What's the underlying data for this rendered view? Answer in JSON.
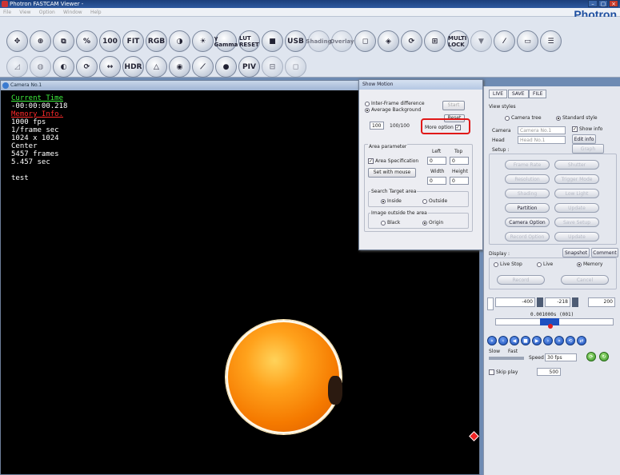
{
  "window": {
    "title": "Photron FASTCAM Viewer -",
    "brand": "Photron"
  },
  "menu": [
    "File",
    "View",
    "Option",
    "Window",
    "Help"
  ],
  "toolbar": {
    "row1": [
      "✥",
      "⊕",
      "⧉",
      "%",
      "100",
      "FIT",
      "RGB",
      "◑",
      "☀",
      "γ Gamma",
      "LUT RESET",
      "■",
      "USB",
      "Shading",
      "Overlay",
      "◻",
      "◈",
      "⟳",
      "⊞",
      "MULTI LOCK",
      "▼",
      "⁄",
      "▭",
      "☰"
    ],
    "row2": [
      "◿",
      "◍",
      "◐",
      "⟳",
      "↔",
      "HDR",
      "△",
      "◉",
      "⟋",
      "●",
      "PIV",
      "⊟",
      "◻"
    ]
  },
  "camera": {
    "title": "Camera No.1",
    "current_time_label": "Current Time",
    "current_time": "-00:00:00.218",
    "memory_label": "Memory Info.",
    "fps": "1000 fps",
    "shutter": "1/frame sec",
    "resolution": "1024 x 1024",
    "position": "Center",
    "frames": "5457 frames",
    "duration": "5.457 sec",
    "comment": "test"
  },
  "show_motion": {
    "title": "Show Motion",
    "inter_frame": "Inter-Frame difference",
    "average_bg": "Average Background",
    "start": "Start",
    "reset": "Reset",
    "count_value": "100",
    "count_of": "100/100",
    "more_option": "More option",
    "area_parameter": "Area parameter",
    "left_label": "Left",
    "top_label": "Top",
    "area_spec": "Area Specification",
    "left_value": "0",
    "top_value": "0",
    "set_with_mouse": "Set with mouse",
    "width_label": "Width",
    "height_label": "Height",
    "width_value": "0",
    "height_value": "0",
    "search_target": "Search Target area",
    "inside": "Inside",
    "outside": "Outside",
    "image_outside": "Image outside the area",
    "black": "Black",
    "origin": "Origin"
  },
  "panel": {
    "tabs": [
      "LIVE",
      "SAVE",
      "FILE"
    ],
    "view_styles": "View styles",
    "camera_tree": "Camera tree",
    "standard_style": "Standard style",
    "camera_label": "Camera",
    "camera_value": "Camera No.1",
    "show_info": "Show info",
    "head_label": "Head",
    "head_value": "Head No.1",
    "edit_info": "Edit info",
    "setup_label": "Setup :",
    "graph": "Graph",
    "frame_rate": "Frame Rate",
    "shutter": "Shutter",
    "resolution": "Resolution",
    "trigger_mode": "Trigger Mode",
    "shading": "Shading",
    "low_light": "Low Light",
    "partition": "Partition",
    "update": "Update",
    "camera_option": "Camera Option",
    "save_setup": "Save Setup",
    "record_option": "Record Option",
    "update2": "Update",
    "display_label": "Display :",
    "snapshot": "Snapshot",
    "comment": "Comment",
    "live_stop": "Live Stop",
    "live": "Live",
    "memory": "Memory",
    "record": "Record",
    "cancel": "Cancel",
    "pos_left": "-400",
    "pos_mid": "-218",
    "pos_right": "200",
    "time_readout": "0.001000s (001)",
    "slow": "Slow",
    "fast": "Fast",
    "speed_label": "Speed",
    "speed_value": "30 fps",
    "skip_label": "Skip play",
    "skip_value": "500"
  }
}
